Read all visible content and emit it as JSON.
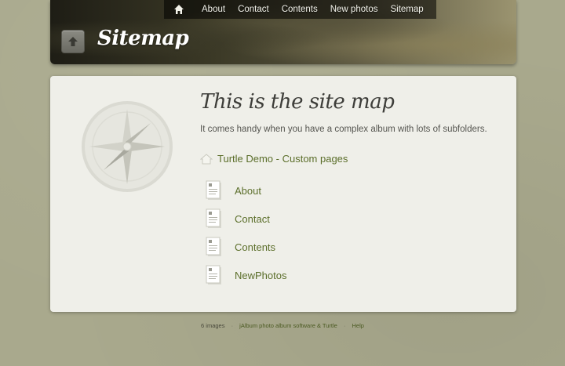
{
  "nav": {
    "items": [
      {
        "label": "About"
      },
      {
        "label": "Contact"
      },
      {
        "label": "Contents"
      },
      {
        "label": "New photos"
      },
      {
        "label": "Sitemap"
      }
    ]
  },
  "header": {
    "title": "Sitemap"
  },
  "main": {
    "heading": "This is the site map",
    "intro": "It comes handy when you have a complex album with lots of subfolders.",
    "root_label": "Turtle Demo - Custom pages",
    "pages": [
      {
        "label": "About"
      },
      {
        "label": "Contact"
      },
      {
        "label": "Contents"
      },
      {
        "label": "NewPhotos"
      }
    ]
  },
  "footer": {
    "count": "6 images",
    "credit": "jAlbum photo album software & Turtle",
    "help": "Help"
  },
  "colors": {
    "background": "#a9a98d",
    "panel": "#efefe9",
    "link": "#5b6e2a"
  }
}
